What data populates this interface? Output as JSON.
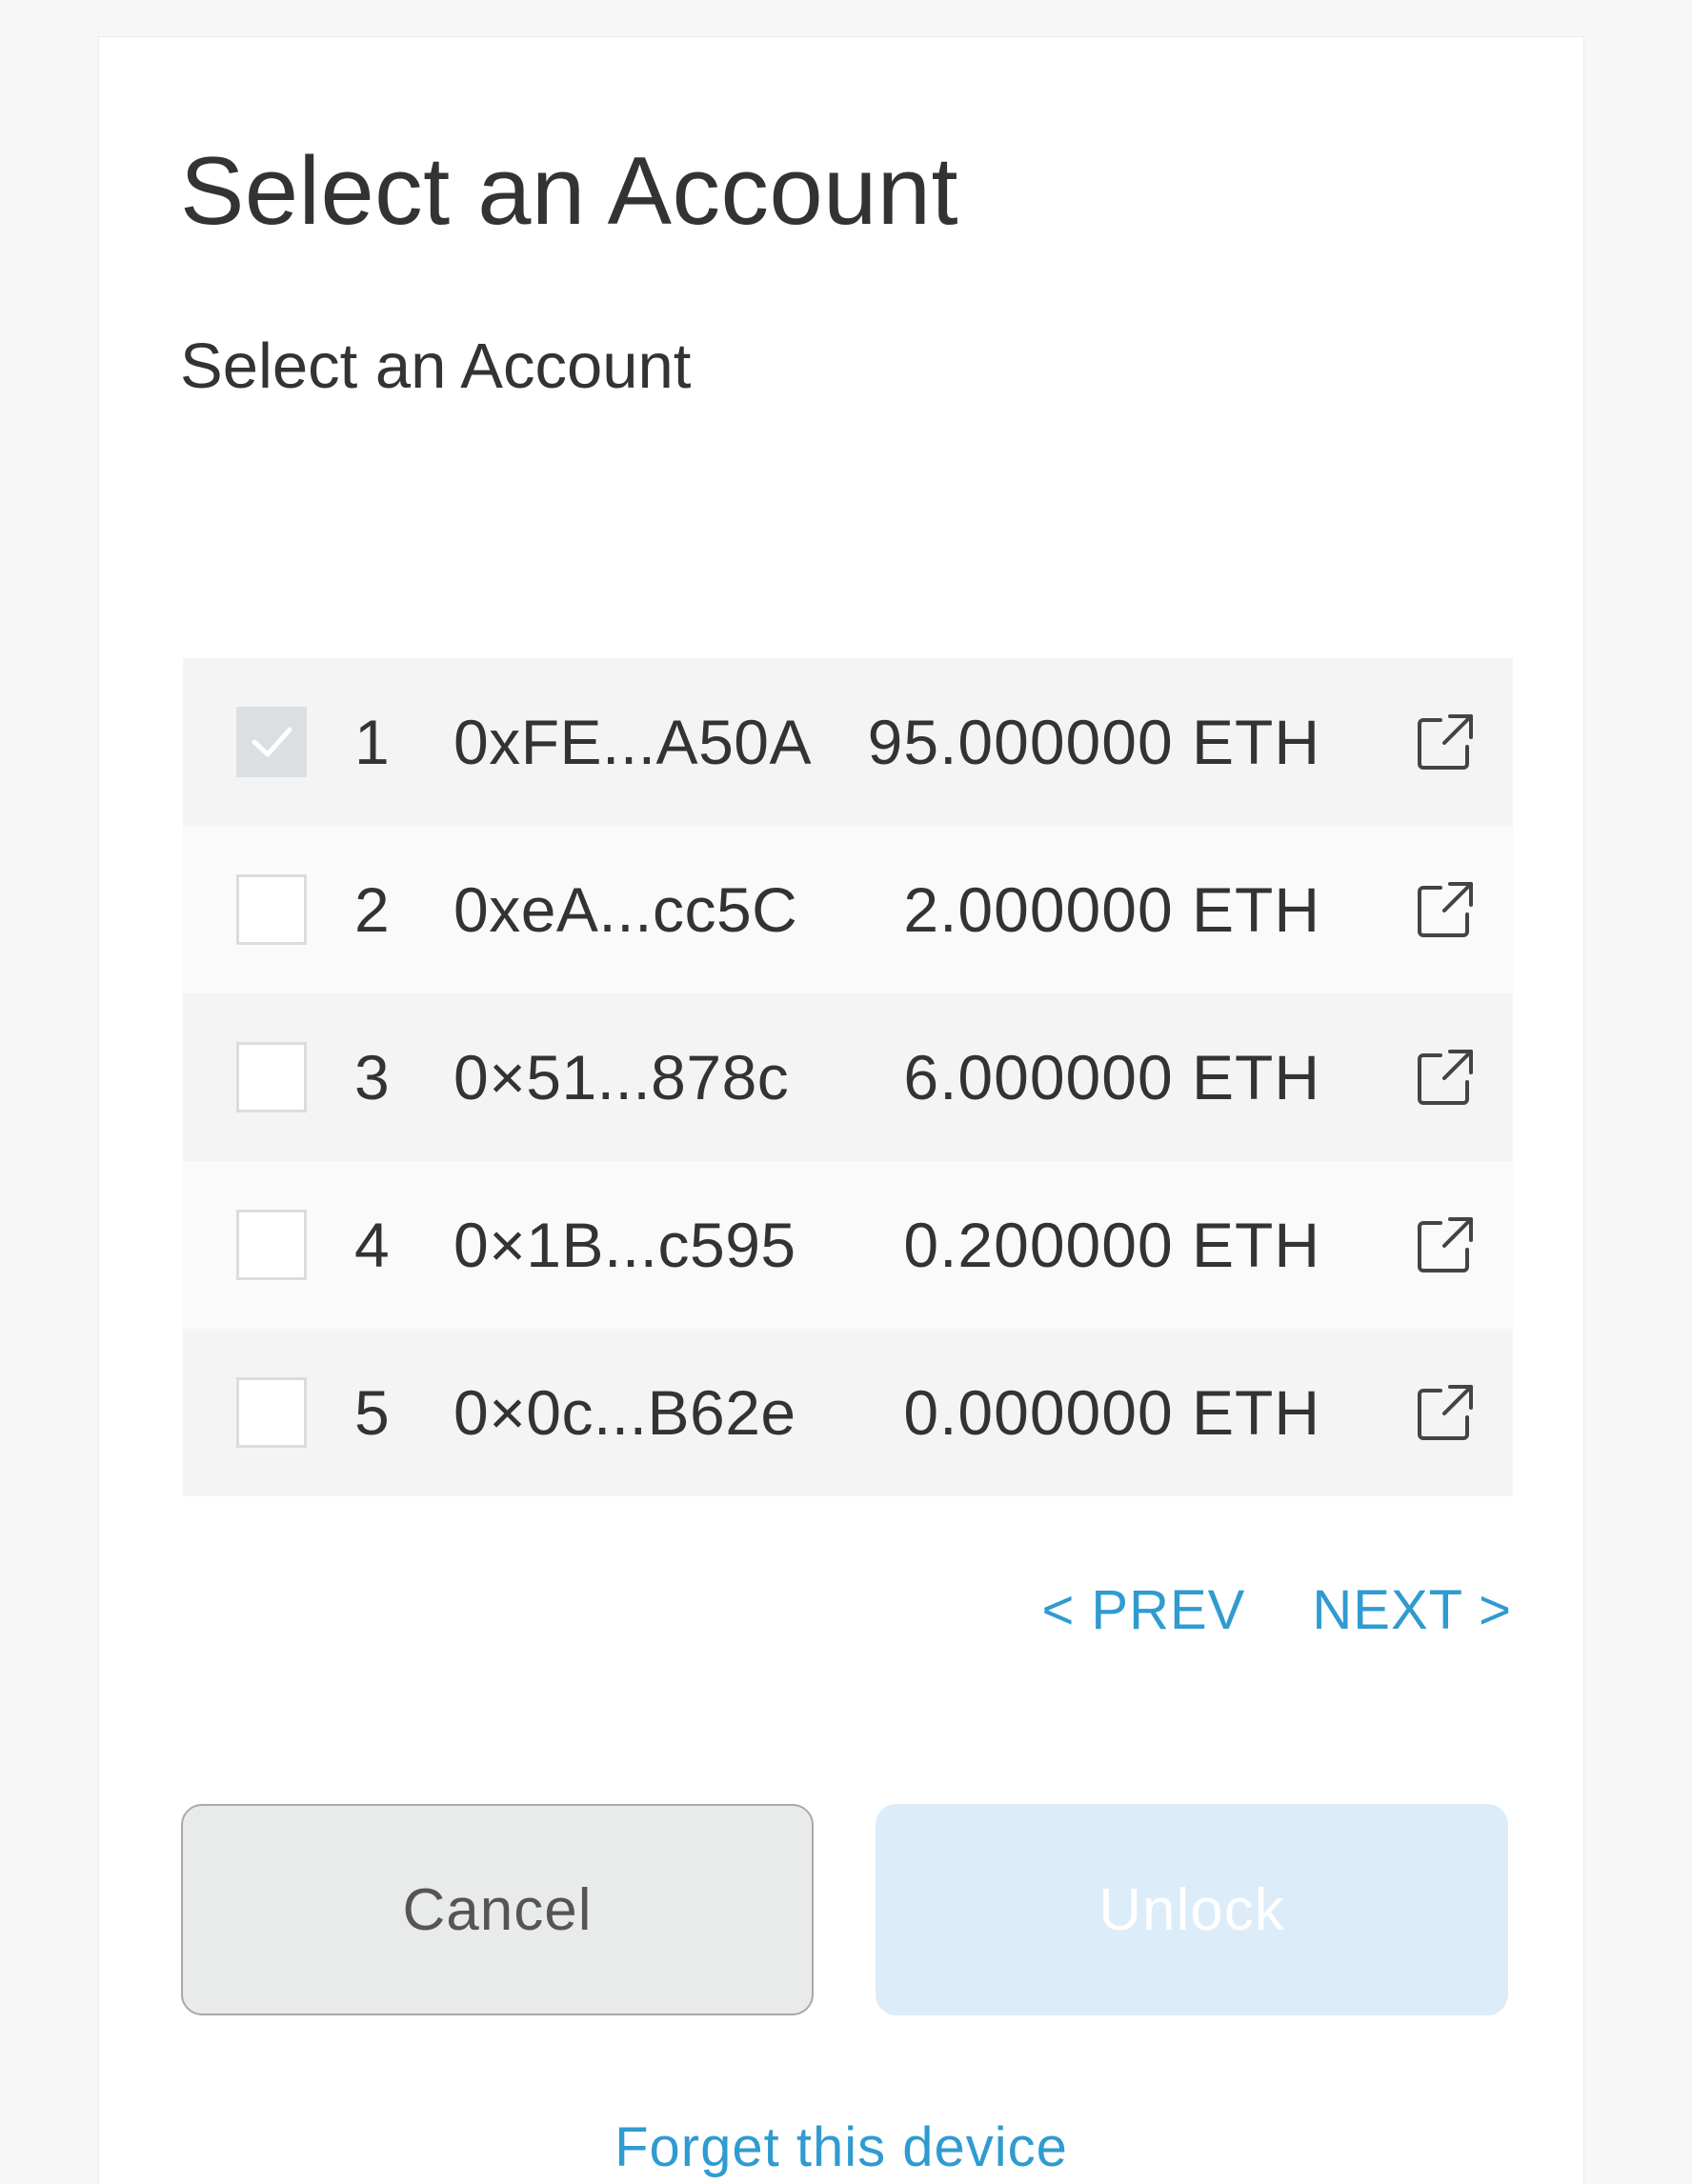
{
  "dialog": {
    "title": "Select an Account",
    "subtitle": "Select an Account"
  },
  "accounts": [
    {
      "index": "1",
      "address": "0xFE...A50A",
      "balance": "95.000000 ETH",
      "selected": true
    },
    {
      "index": "2",
      "address": "0xeA...cc5C",
      "balance": "2.000000 ETH",
      "selected": false
    },
    {
      "index": "3",
      "address": "0×51...878c",
      "balance": "6.000000 ETH",
      "selected": false
    },
    {
      "index": "4",
      "address": "0×1B...c595",
      "balance": "0.200000 ETH",
      "selected": false
    },
    {
      "index": "5",
      "address": "0×0c...B62e",
      "balance": "0.000000 ETH",
      "selected": false
    }
  ],
  "pagination": {
    "prev_label": "< PREV",
    "next_label": "NEXT >"
  },
  "actions": {
    "cancel_label": "Cancel",
    "unlock_label": "Unlock",
    "forget_label": "Forget this device"
  },
  "icons": {
    "checkbox_check": "check-icon",
    "external_link": "external-link-icon"
  },
  "colors": {
    "link": "#2f9bd0",
    "unlock_bg_disabled": "#dcecf9",
    "row_odd": "#f4f4f4",
    "row_even": "#fafafa",
    "checked_bg": "#dcdfe2"
  }
}
